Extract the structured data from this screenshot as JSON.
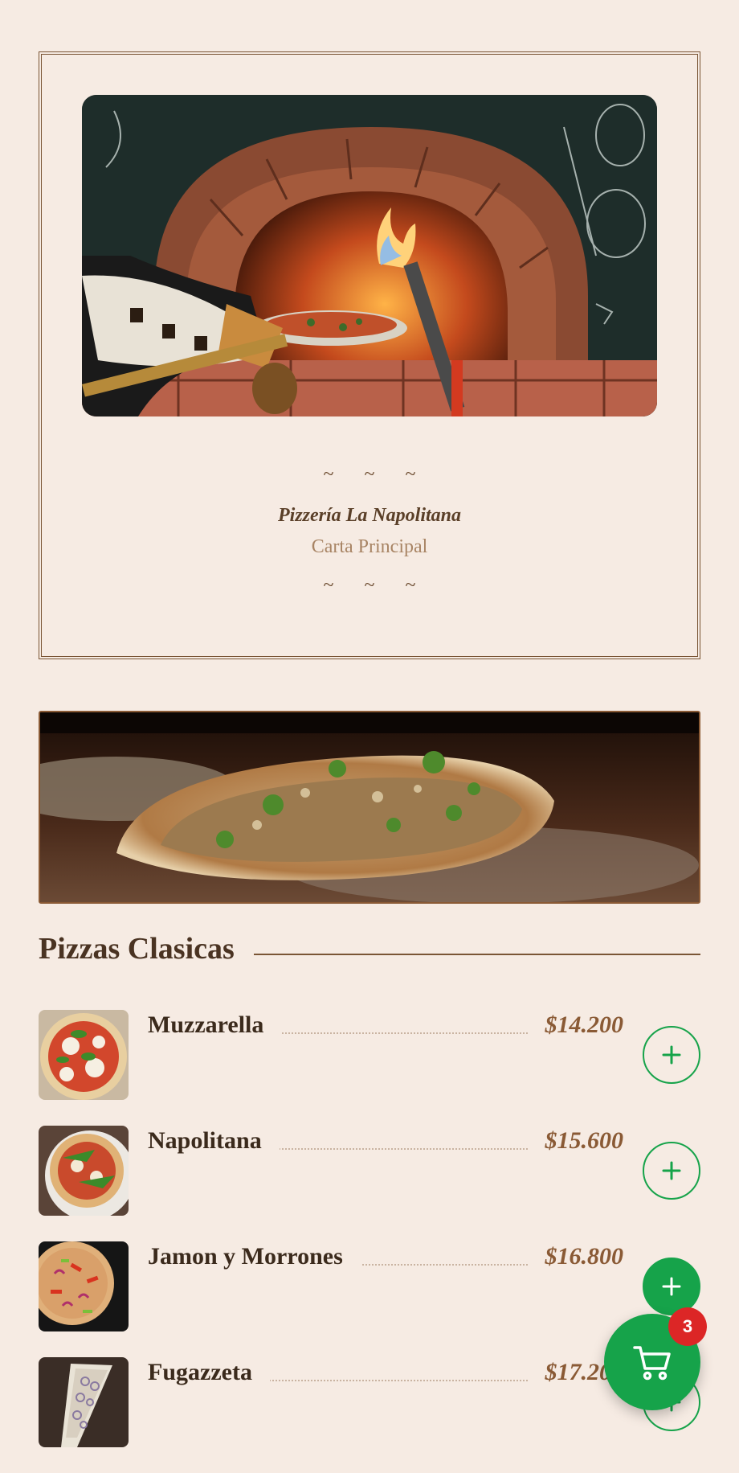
{
  "hero": {
    "image_alt": "wood-fired-oven",
    "ornament_top": "~ ~ ~",
    "name": "Pizzería La Napolitana",
    "subtitle": "Carta Principal",
    "ornament_bottom": "~ ~ ~"
  },
  "category": {
    "banner_alt": "pizza-on-peel",
    "title": "Pizzas Clasicas"
  },
  "menu": {
    "items": [
      {
        "name": "Muzzarella",
        "price": "$14.200",
        "thumb": "pizza-muzzarella"
      },
      {
        "name": "Napolitana",
        "price": "$15.600",
        "thumb": "pizza-napolitana"
      },
      {
        "name": "Jamon y Morrones",
        "price": "$16.800",
        "thumb": "pizza-jamon-morrones"
      },
      {
        "name": "Fugazzeta",
        "price": "$17.200",
        "thumb": "pizza-fugazzeta"
      }
    ]
  },
  "cart": {
    "count": "3",
    "icon": "shopping-cart-icon"
  },
  "colors": {
    "background": "#f6ebe3",
    "accent_green": "#16a34a",
    "badge_red": "#dc2626",
    "brown": "#7a5535"
  }
}
